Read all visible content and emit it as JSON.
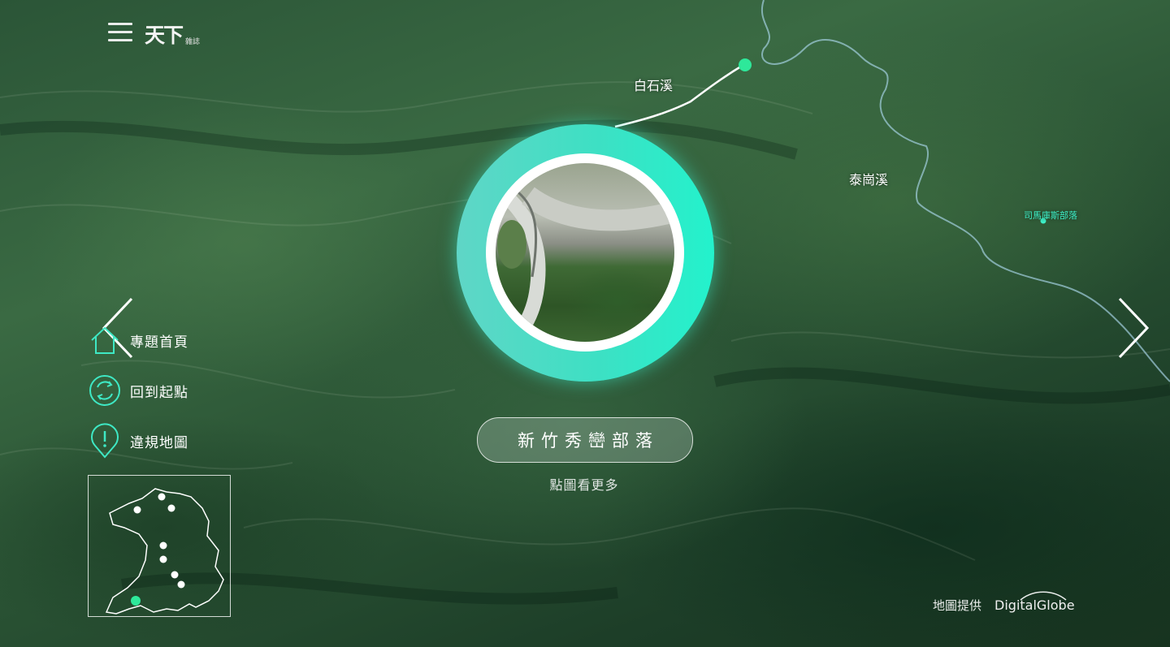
{
  "header": {
    "logo_main": "天下",
    "logo_sub": "雜誌",
    "menu_icon": "hamburger-menu-icon"
  },
  "side_menu": [
    {
      "label": "專題首頁",
      "icon": "home-icon"
    },
    {
      "label": "回到起點",
      "icon": "refresh-icon"
    },
    {
      "label": "違規地圖",
      "icon": "alert-pin-icon"
    }
  ],
  "map_labels": {
    "river_baishi": "白石溪",
    "river_taigang": "泰崗溪",
    "village_smangus": "司馬庫斯部落"
  },
  "center": {
    "village_name": "新竹秀巒部落",
    "hint": "點圖看更多"
  },
  "credit": {
    "text": "地圖提供",
    "brand": "DigitalGlobe"
  },
  "colors": {
    "accent": "#3ee8c4",
    "marker": "#2ee89a"
  }
}
